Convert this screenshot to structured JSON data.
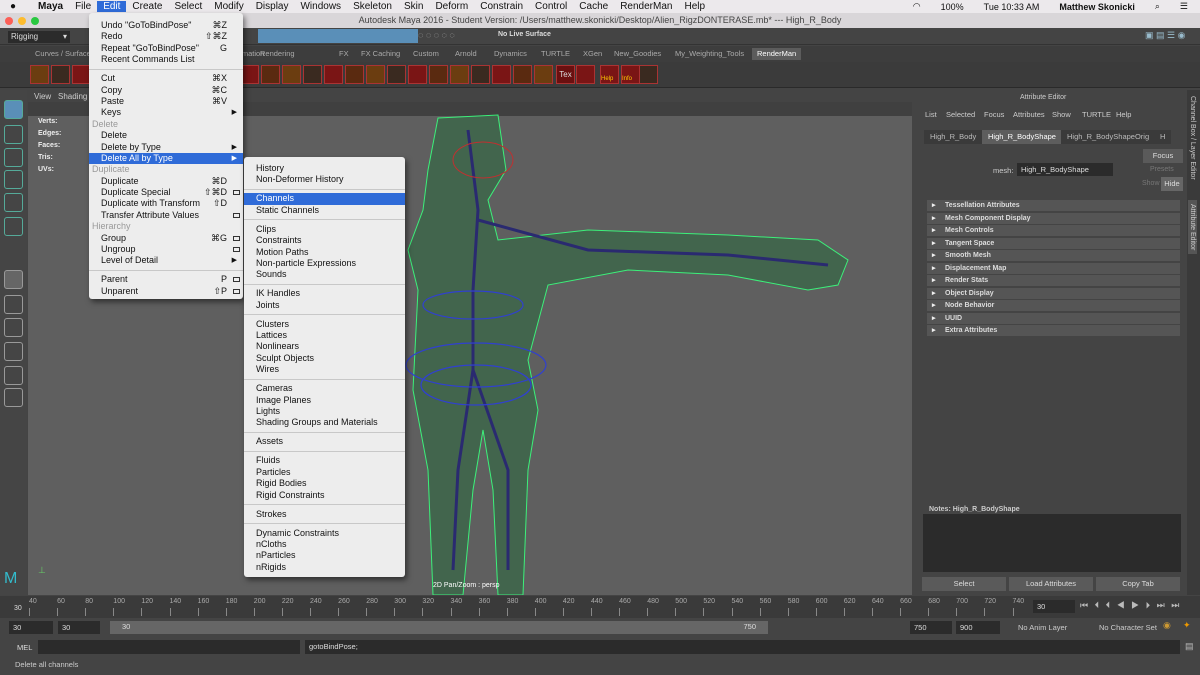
{
  "macbar": {
    "items": [
      "Maya",
      "File",
      "Edit",
      "Create",
      "Select",
      "Modify",
      "Display",
      "Windows",
      "Skeleton",
      "Skin",
      "Deform",
      "Constrain",
      "Control",
      "Cache",
      "RenderMan",
      "Help"
    ],
    "battery": "100%",
    "clock": "Tue 10:33 AM",
    "user": "Matthew Skonicki"
  },
  "window": {
    "title": "Autodesk Maya 2016 - Student Version: /Users/matthew.skonicki/Desktop/Alien_RigzDONTERASE.mb*  ---  High_R_Body"
  },
  "toolbar": {
    "mode": "Rigging",
    "live_surface": "No Live Surface"
  },
  "shelf_tabs": [
    {
      "label": "Curves / Surfaces"
    },
    {
      "label": "Animation"
    },
    {
      "label": "Rendering"
    },
    {
      "label": "FX"
    },
    {
      "label": "FX Caching"
    },
    {
      "label": "Custom"
    },
    {
      "label": "Arnold"
    },
    {
      "label": "Dynamics"
    },
    {
      "label": "TURTLE"
    },
    {
      "label": "XGen"
    },
    {
      "label": "New_Goodies"
    },
    {
      "label": "My_Weighting_Tools"
    },
    {
      "label": "RenderMan"
    }
  ],
  "shelf_icon_labels": {
    "tex": "Tex",
    "help": "Help",
    "info": "Info"
  },
  "viewport": {
    "menu": [
      "View",
      "Shading"
    ],
    "hud": [
      "Verts:",
      "Edges:",
      "Faces:",
      "Tris:",
      "UVs:"
    ],
    "camera_label": "2D Pan/Zoom : persp"
  },
  "edit_menu": [
    {
      "t": "item",
      "label": "Undo \"GoToBindPose\"",
      "sc": "⌘Z"
    },
    {
      "t": "item",
      "label": "Redo",
      "sc": "⇧⌘Z"
    },
    {
      "t": "item",
      "label": "Repeat \"GoToBindPose\"",
      "sc": "G"
    },
    {
      "t": "item",
      "label": "Recent Commands List"
    },
    {
      "t": "sep"
    },
    {
      "t": "item",
      "label": "Cut",
      "sc": "⌘X"
    },
    {
      "t": "item",
      "label": "Copy",
      "sc": "⌘C"
    },
    {
      "t": "item",
      "label": "Paste",
      "sc": "⌘V"
    },
    {
      "t": "item",
      "label": "Keys",
      "sub": true
    },
    {
      "t": "hdr",
      "label": "Delete"
    },
    {
      "t": "item",
      "label": "Delete"
    },
    {
      "t": "item",
      "label": "Delete by Type",
      "sub": true
    },
    {
      "t": "item",
      "label": "Delete All by Type",
      "sub": true,
      "hl": true
    },
    {
      "t": "hdr",
      "label": "Duplicate"
    },
    {
      "t": "item",
      "label": "Duplicate",
      "sc": "⌘D"
    },
    {
      "t": "item",
      "label": "Duplicate Special",
      "sc": "⇧⌘D",
      "opt": true
    },
    {
      "t": "item",
      "label": "Duplicate with Transform",
      "sc": "⇧D"
    },
    {
      "t": "item",
      "label": "Transfer Attribute Values",
      "opt": true
    },
    {
      "t": "hdr",
      "label": "Hierarchy"
    },
    {
      "t": "item",
      "label": "Group",
      "sc": "⌘G",
      "opt": true
    },
    {
      "t": "item",
      "label": "Ungroup",
      "opt": true
    },
    {
      "t": "item",
      "label": "Level of Detail",
      "sub": true
    },
    {
      "t": "sep"
    },
    {
      "t": "item",
      "label": "Parent",
      "sc": "P",
      "opt": true
    },
    {
      "t": "item",
      "label": "Unparent",
      "sc": "⇧P",
      "opt": true
    }
  ],
  "submenu": [
    {
      "t": "item",
      "label": "History"
    },
    {
      "t": "item",
      "label": "Non-Deformer History"
    },
    {
      "t": "sep"
    },
    {
      "t": "item",
      "label": "Channels",
      "hl": true
    },
    {
      "t": "item",
      "label": "Static Channels"
    },
    {
      "t": "sep"
    },
    {
      "t": "item",
      "label": "Clips"
    },
    {
      "t": "item",
      "label": "Constraints"
    },
    {
      "t": "item",
      "label": "Motion Paths"
    },
    {
      "t": "item",
      "label": "Non-particle Expressions"
    },
    {
      "t": "item",
      "label": "Sounds"
    },
    {
      "t": "sep"
    },
    {
      "t": "item",
      "label": "IK Handles"
    },
    {
      "t": "item",
      "label": "Joints"
    },
    {
      "t": "sep"
    },
    {
      "t": "item",
      "label": "Clusters"
    },
    {
      "t": "item",
      "label": "Lattices"
    },
    {
      "t": "item",
      "label": "Nonlinears"
    },
    {
      "t": "item",
      "label": "Sculpt Objects"
    },
    {
      "t": "item",
      "label": "Wires"
    },
    {
      "t": "sep"
    },
    {
      "t": "item",
      "label": "Cameras"
    },
    {
      "t": "item",
      "label": "Image Planes"
    },
    {
      "t": "item",
      "label": "Lights"
    },
    {
      "t": "item",
      "label": "Shading Groups and Materials"
    },
    {
      "t": "sep"
    },
    {
      "t": "item",
      "label": "Assets"
    },
    {
      "t": "sep"
    },
    {
      "t": "item",
      "label": "Fluids"
    },
    {
      "t": "item",
      "label": "Particles"
    },
    {
      "t": "item",
      "label": "Rigid Bodies"
    },
    {
      "t": "item",
      "label": "Rigid Constraints"
    },
    {
      "t": "sep"
    },
    {
      "t": "item",
      "label": "Strokes"
    },
    {
      "t": "sep"
    },
    {
      "t": "item",
      "label": "Dynamic Constraints"
    },
    {
      "t": "item",
      "label": "nCloths"
    },
    {
      "t": "item",
      "label": "nParticles"
    },
    {
      "t": "item",
      "label": "nRigids"
    }
  ],
  "attribute_editor": {
    "title": "Attribute Editor",
    "menu": [
      "List",
      "Selected",
      "Focus",
      "Attributes",
      "Show",
      "TURTLE",
      "Help"
    ],
    "tabs": [
      {
        "label": "High_R_Body"
      },
      {
        "label": "High_R_BodyShape"
      },
      {
        "label": "High_R_BodyShapeOrig"
      },
      {
        "label": "H"
      }
    ],
    "mesh_label": "mesh:",
    "mesh_value": "High_R_BodyShape",
    "focus": "Focus",
    "presets": "Presets",
    "show": "Show",
    "hide": "Hide",
    "sections": [
      "Tessellation Attributes",
      "Mesh Component Display",
      "Mesh Controls",
      "Tangent Space",
      "Smooth Mesh",
      "Displacement Map",
      "Render Stats",
      "Object Display",
      "Node Behavior",
      "UUID",
      "Extra Attributes"
    ],
    "notes": "Notes:  High_R_BodyShape",
    "buttons": [
      "Select",
      "Load Attributes",
      "Copy Tab"
    ]
  },
  "side_tabs": [
    "Channel Box / Layer Editor",
    "Attribute Editor"
  ],
  "timeline": {
    "ticks": [
      "40",
      "60",
      "80",
      "100",
      "120",
      "140",
      "160",
      "180",
      "200",
      "220",
      "240",
      "260",
      "280",
      "300",
      "320",
      "340",
      "360",
      "380",
      "400",
      "420",
      "440",
      "460",
      "480",
      "500",
      "520",
      "540",
      "560",
      "580",
      "600",
      "620",
      "640",
      "660",
      "680",
      "700",
      "720",
      "740"
    ],
    "current": "30",
    "current_field": "30"
  },
  "range": {
    "start": "30",
    "anim_start": "30",
    "slider_start": "30",
    "slider_end": "750",
    "anim_end": "750",
    "end": "900",
    "anim_layer": "No Anim Layer",
    "character_set": "No Character Set"
  },
  "command_line": {
    "lang": "MEL",
    "input": "",
    "result": "gotoBindPose;"
  },
  "help_line": "Delete all channels"
}
